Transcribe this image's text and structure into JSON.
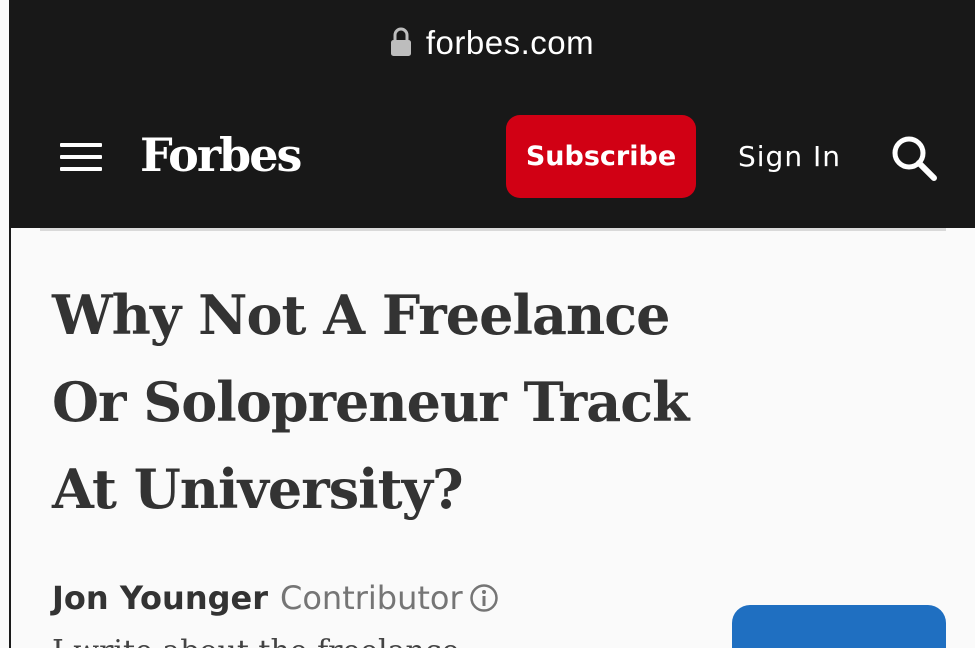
{
  "browser": {
    "url": "forbes.com",
    "lock_icon": "lock-icon"
  },
  "header": {
    "menu_icon": "hamburger-menu-icon",
    "logo": "Forbes",
    "subscribe_label": "Subscribe",
    "signin_label": "Sign In",
    "search_icon": "search-icon"
  },
  "article": {
    "title": "Why Not A Freelance Or Solopreneur Track At University?",
    "author": {
      "name": "Jon Younger",
      "role": "Contributor",
      "info_icon": "info-icon"
    },
    "bio_partial": "I write about the freelance"
  },
  "colors": {
    "header_bg": "#181818",
    "subscribe_bg": "#d10014",
    "follow_bg": "#1f6fc1",
    "headline": "#333333"
  }
}
